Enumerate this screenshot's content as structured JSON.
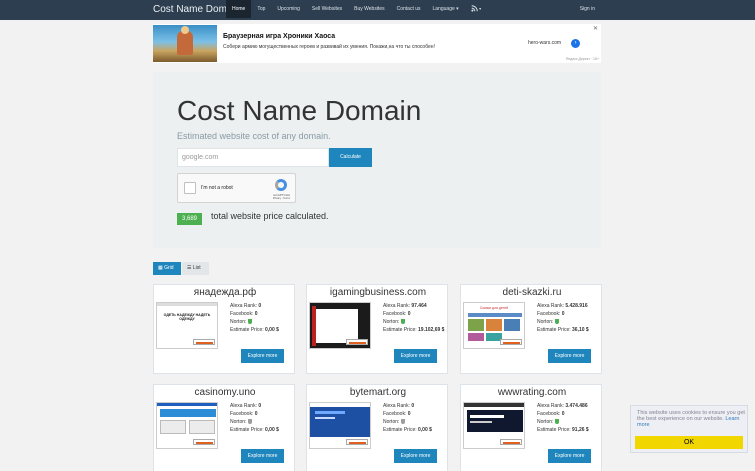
{
  "navbar": {
    "brand": "Cost Name Domain",
    "items": [
      "Home",
      "Top",
      "Upcoming",
      "Sell Websites",
      "Buy Websites",
      "Contact us",
      "Language ▾"
    ],
    "rss_icon": "rss-icon",
    "signin": "Sign in",
    "bg_color": "#2c3e50"
  },
  "ad": {
    "title": "Браузерная игра Хроники Хаоса",
    "subtitle": "Собери армию могущественных героев и развивай их умения. Покажи,на что ты способен!",
    "domain": "hero-wars.com",
    "arrow": "›",
    "close": "✕",
    "footer": "Яндекс.Директ · 18+"
  },
  "hero": {
    "title": "Cost Name Domain",
    "subtitle": "Estimated website cost of any domain.",
    "input_placeholder": "google.com",
    "button": "Calculate",
    "captcha_label": "I'm not a robot",
    "captcha_brand": "reCAPTCHA",
    "captcha_links": "Privacy - Terms",
    "counter": "3,689",
    "counter_label": "total website price calculated."
  },
  "view": {
    "grid": "▦ Grid",
    "list": "☰ List"
  },
  "labels": {
    "alexa": "Alexa Rank:",
    "facebook": "Facebook:",
    "norton": "Norton:",
    "price": "Estimate Price:",
    "explore": "Explore more"
  },
  "cards": [
    {
      "domain": "янадежда.рф",
      "alexa": "0",
      "facebook": "0",
      "norton_color": "#4caf50",
      "price": "0,00 $"
    },
    {
      "domain": "igamingbusiness.com",
      "alexa": "97.464",
      "facebook": "0",
      "norton_color": "#4caf50",
      "price": "19.102,69 $"
    },
    {
      "domain": "deti-skazki.ru",
      "alexa": "5.428.916",
      "facebook": "0",
      "norton_color": "#4caf50",
      "price": "36,10 $"
    },
    {
      "domain": "casinomy.uno",
      "alexa": "0",
      "facebook": "0",
      "norton_color": "#9e9e9e",
      "price": "0,00 $"
    },
    {
      "domain": "bytemart.org",
      "alexa": "0",
      "facebook": "0",
      "norton_color": "#9e9e9e",
      "price": "0,00 $"
    },
    {
      "domain": "wwwrating.com",
      "alexa": "3.474.486",
      "facebook": "0",
      "norton_color": "#4caf50",
      "price": "91,26 $"
    }
  ],
  "thumbs": {
    "t1_text": "ОДЕТЬ НАДЕЖДУ НАДЕТЬ ОДЕЖДУ",
    "t3_title": "Сказки для детей"
  },
  "cookie": {
    "text": "This website uses cookies to ensure you get the best experience on our website.",
    "link": "Learn more",
    "ok": "OK"
  }
}
